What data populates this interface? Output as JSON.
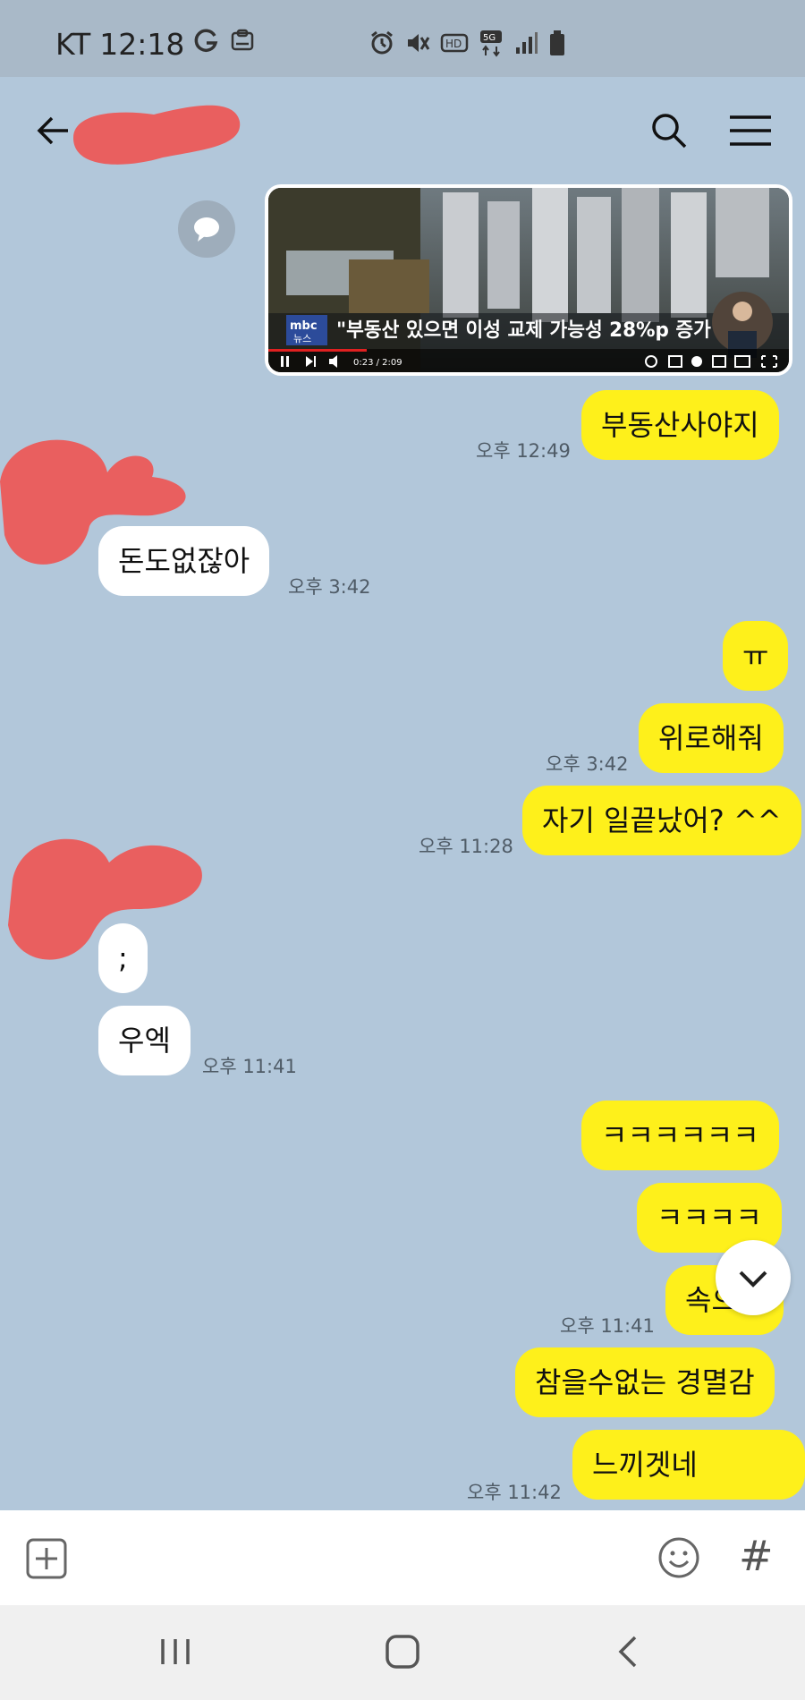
{
  "status_bar": {
    "carrier": "KT",
    "time": "12:18",
    "network": "5G"
  },
  "header": {
    "contact_name_hidden": true
  },
  "video": {
    "channel_badge_top": "mbc",
    "channel_badge_bottom": "뉴스",
    "headline": "\"부동산 있으면 이성 교제 가능성 28%p 증가\"",
    "time_current": "0:23",
    "time_total": "2:09",
    "time_display": "0:23 / 2:09"
  },
  "messages": [
    {
      "sender": "me",
      "text": "부동산사야지",
      "time": "오후 12:49"
    },
    {
      "sender": "them",
      "text": "돈도없잖아",
      "time": "오후 3:42"
    },
    {
      "sender": "me",
      "text": "ㅠ",
      "time": ""
    },
    {
      "sender": "me",
      "text": "위로해줘",
      "time": "오후 3:42"
    },
    {
      "sender": "me",
      "text": "자기 일끝났어? ^^",
      "time": "오후 11:28"
    },
    {
      "sender": "them",
      "text": ";",
      "time": ""
    },
    {
      "sender": "them",
      "text": "우엑",
      "time": "오후 11:41"
    },
    {
      "sender": "me",
      "text": "ㅋㅋㅋㅋㅋㅋ",
      "time": ""
    },
    {
      "sender": "me",
      "text": "ㅋㅋㅋㅋ",
      "time": ""
    },
    {
      "sender": "me",
      "text": "속으로",
      "time": "오후 11:41"
    },
    {
      "sender": "me",
      "text": "참을수없는 경멸감",
      "time": ""
    },
    {
      "sender": "me",
      "text": "느끼겟네",
      "time": "오후 11:42"
    }
  ],
  "input_bar": {
    "message_value": "",
    "hash_label": "#"
  },
  "colors": {
    "chat_background": "#b2c7da",
    "my_bubble": "#fef01b",
    "their_bubble": "#ffffff",
    "status_bar": "#a9b9c8",
    "redaction": "#e95f5f"
  }
}
